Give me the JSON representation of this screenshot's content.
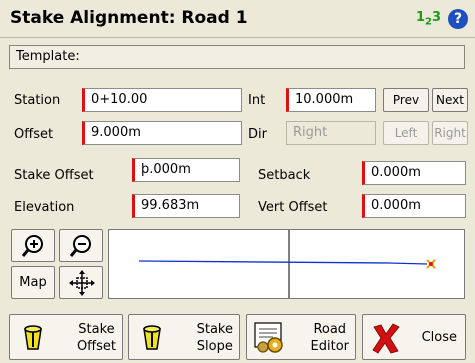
{
  "window": {
    "title": "Stake Alignment: Road 1",
    "badge": "123"
  },
  "template": {
    "label": "Template:"
  },
  "station": {
    "label": "Station",
    "value": "0+10.00"
  },
  "interval": {
    "label": "Int",
    "value": "10.000m",
    "prev": "Prev",
    "next": "Next"
  },
  "offset": {
    "label": "Offset",
    "value": "9.000m"
  },
  "direction": {
    "label": "Dir",
    "value": "Right",
    "left": "Left",
    "right": "Right"
  },
  "stake_offset": {
    "label": "Stake Offset",
    "value": "þ.000m"
  },
  "setback": {
    "label": "Setback",
    "value": "0.000m"
  },
  "elevation": {
    "label": "Elevation",
    "value": "99.683m"
  },
  "vert_offset": {
    "label": "Vert Offset",
    "value": "0.000m"
  },
  "map": {
    "label": "Map"
  },
  "bottom": {
    "stake_offset_1": "Stake",
    "stake_offset_2": "Offset",
    "stake_slope_1": "Stake",
    "stake_slope_2": "Slope",
    "road_editor_1": "Road",
    "road_editor_2": "Editor",
    "close": "Close"
  },
  "colors": {
    "alignment_line": "#1030d0",
    "stake_marker": "#e8a000",
    "required_marker": "#d11111"
  }
}
